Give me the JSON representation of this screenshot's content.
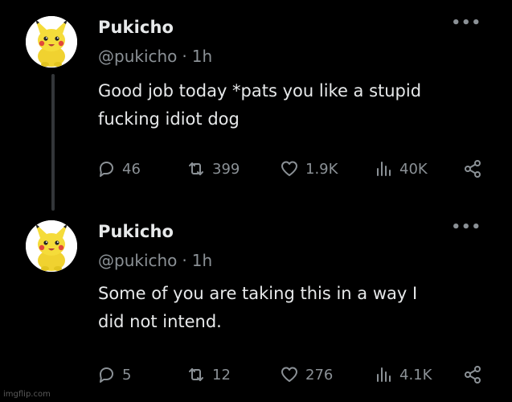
{
  "tweets": [
    {
      "author_name": "Pukicho",
      "handle": "@pukicho",
      "separator": "·",
      "time": "1h",
      "more_label": "•••",
      "text_lines": [
        "Good job today *pats you like a stupid",
        "fucking idiot dog"
      ],
      "replies": "46",
      "retweets": "399",
      "likes": "1.9K",
      "views": "40K"
    },
    {
      "author_name": "Pukicho",
      "handle": "@pukicho",
      "separator": "·",
      "time": "1h",
      "more_label": "•••",
      "text_lines": [
        "Some of you are taking this in a way I",
        "did not intend."
      ],
      "replies": "5",
      "retweets": "12",
      "likes": "276",
      "views": "4.1K"
    }
  ],
  "icons": {
    "reply": "reply-icon",
    "retweet": "retweet-icon",
    "like": "heart-icon",
    "views": "views-icon",
    "share": "share-icon",
    "avatar": "pikachu-plush-avatar"
  },
  "colors": {
    "background": "#000000",
    "primary_text": "#e7e9ea",
    "secondary_text": "#8b9196",
    "thread_line": "#333639",
    "avatar_yellow": "#f5dc3a"
  },
  "watermark": "imgflip.com"
}
